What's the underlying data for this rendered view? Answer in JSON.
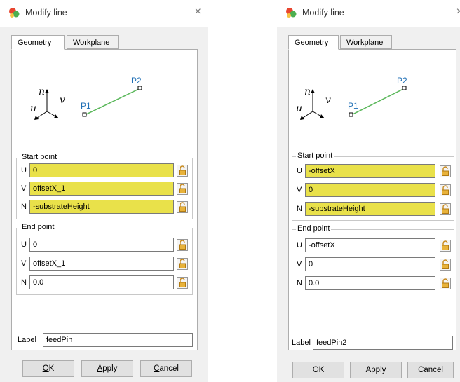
{
  "dialogs": [
    {
      "title": "Modify line",
      "close_glyph": "×",
      "tabs": [
        "Geometry",
        "Workplane"
      ],
      "diagram": {
        "axis_n": "n",
        "axis_v": "v",
        "axis_u": "u",
        "p1": "P1",
        "p2": "P2"
      },
      "start_point": {
        "title": "Start point",
        "rows": [
          {
            "axis": "U",
            "value": "0"
          },
          {
            "axis": "V",
            "value": "offsetX_1"
          },
          {
            "axis": "N",
            "value": "-substrateHeight"
          }
        ]
      },
      "end_point": {
        "title": "End point",
        "rows": [
          {
            "axis": "U",
            "value": "0"
          },
          {
            "axis": "V",
            "value": "offsetX_1"
          },
          {
            "axis": "N",
            "value": "0.0"
          }
        ]
      },
      "label_caption": "Label",
      "label_value": "feedPin",
      "buttons": {
        "ok_mnemonic": "O",
        "ok_rest": "K",
        "apply_mnemonic": "A",
        "apply_rest": "pply",
        "cancel_mnemonic": "C",
        "cancel_rest": "ancel"
      }
    },
    {
      "title": "Modify line",
      "close_glyph": "×",
      "tabs": [
        "Geometry",
        "Workplane"
      ],
      "diagram": {
        "axis_n": "n",
        "axis_v": "v",
        "axis_u": "u",
        "p1": "P1",
        "p2": "P2"
      },
      "start_point": {
        "title": "Start point",
        "rows": [
          {
            "axis": "U",
            "value": "-offsetX"
          },
          {
            "axis": "V",
            "value": "0"
          },
          {
            "axis": "N",
            "value": "-substrateHeight"
          }
        ]
      },
      "end_point": {
        "title": "End point",
        "rows": [
          {
            "axis": "U",
            "value": "-offsetX"
          },
          {
            "axis": "V",
            "value": "0"
          },
          {
            "axis": "N",
            "value": "0.0"
          }
        ]
      },
      "label_caption": "Label",
      "label_value": "feedPin2",
      "buttons": {
        "ok_label": "OK",
        "apply_label": "Apply",
        "cancel_label": "Cancel"
      }
    }
  ],
  "colors": {
    "highlight_field": "#e9e14a",
    "point_label": "#1f6fb5",
    "line": "#5cb85c",
    "lock": "#e8b23a"
  },
  "icons": {
    "app": "app-icon",
    "lock": "lock-icon",
    "close": "close-icon"
  }
}
